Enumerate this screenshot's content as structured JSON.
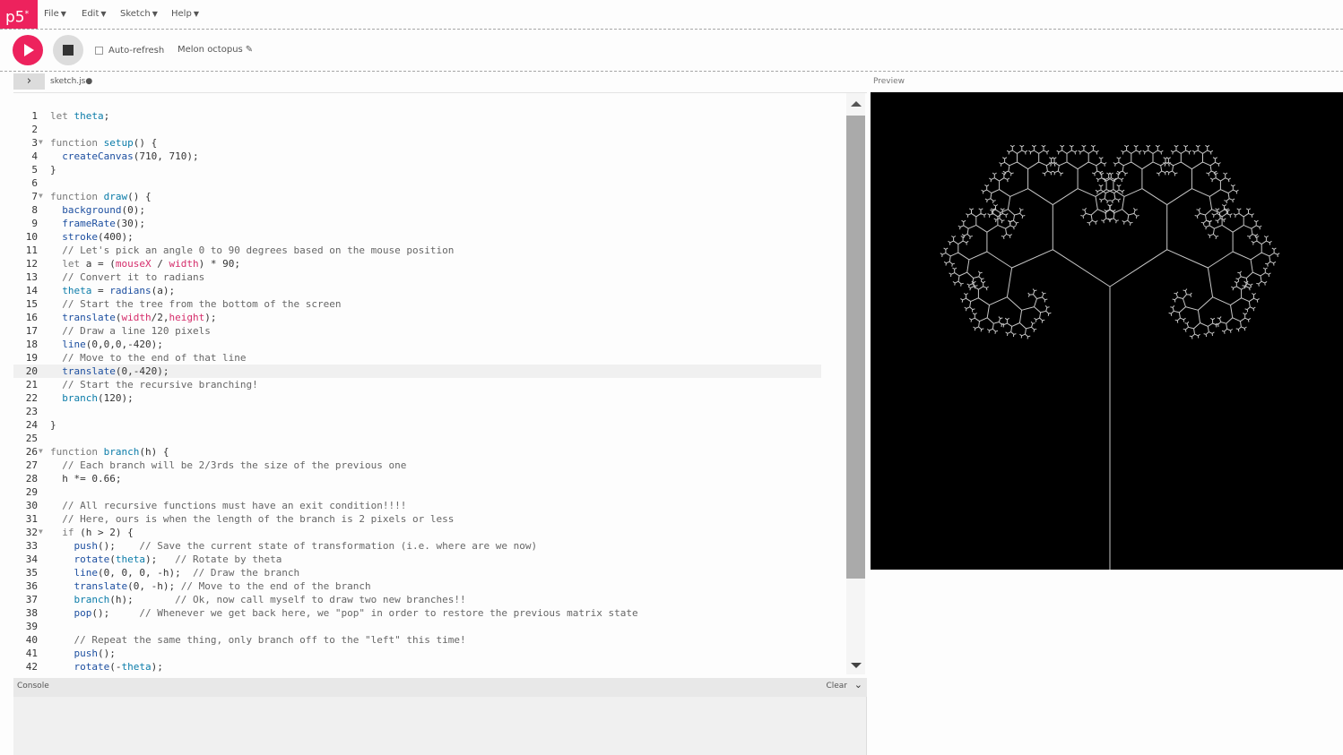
{
  "menubar": {
    "logo": "p5",
    "logo_sup": "*",
    "items": [
      {
        "label": "File"
      },
      {
        "label": "Edit"
      },
      {
        "label": "Sketch"
      },
      {
        "label": "Help"
      }
    ]
  },
  "toolbar": {
    "auto_refresh_label": "Auto-refresh",
    "auto_refresh_checked": false,
    "sketch_name": "Melon octopus"
  },
  "tabs": {
    "file_name": "sketch.js",
    "unsaved_dot": "●"
  },
  "preview": {
    "label": "Preview",
    "background": "#000000",
    "stroke": "#c8c8c8"
  },
  "console": {
    "title": "Console",
    "clear_label": "Clear"
  },
  "editor": {
    "active_line": 20,
    "lines": [
      {
        "n": "1",
        "text": "let theta;"
      },
      {
        "n": "2",
        "text": ""
      },
      {
        "n": "3",
        "text": "function setup() {",
        "fold": true
      },
      {
        "n": "4",
        "text": "  createCanvas(710, 710);"
      },
      {
        "n": "5",
        "text": "}"
      },
      {
        "n": "6",
        "text": ""
      },
      {
        "n": "7",
        "text": "function draw() {",
        "fold": true
      },
      {
        "n": "8",
        "text": "  background(0);"
      },
      {
        "n": "9",
        "text": "  frameRate(30);"
      },
      {
        "n": "10",
        "text": "  stroke(400);"
      },
      {
        "n": "11",
        "text": "  // Let's pick an angle 0 to 90 degrees based on the mouse position"
      },
      {
        "n": "12",
        "text": "  let a = (mouseX / width) * 90;"
      },
      {
        "n": "13",
        "text": "  // Convert it to radians"
      },
      {
        "n": "14",
        "text": "  theta = radians(a);"
      },
      {
        "n": "15",
        "text": "  // Start the tree from the bottom of the screen"
      },
      {
        "n": "16",
        "text": "  translate(width/2,height);"
      },
      {
        "n": "17",
        "text": "  // Draw a line 120 pixels"
      },
      {
        "n": "18",
        "text": "  line(0,0,0,-420);"
      },
      {
        "n": "19",
        "text": "  // Move to the end of that line"
      },
      {
        "n": "20",
        "text": "  translate(0,-420);"
      },
      {
        "n": "21",
        "text": "  // Start the recursive branching!"
      },
      {
        "n": "22",
        "text": "  branch(120);"
      },
      {
        "n": "23",
        "text": ""
      },
      {
        "n": "24",
        "text": "}"
      },
      {
        "n": "25",
        "text": ""
      },
      {
        "n": "26",
        "text": "function branch(h) {",
        "fold": true
      },
      {
        "n": "27",
        "text": "  // Each branch will be 2/3rds the size of the previous one"
      },
      {
        "n": "28",
        "text": "  h *= 0.66;"
      },
      {
        "n": "29",
        "text": ""
      },
      {
        "n": "30",
        "text": "  // All recursive functions must have an exit condition!!!!"
      },
      {
        "n": "31",
        "text": "  // Here, ours is when the length of the branch is 2 pixels or less"
      },
      {
        "n": "32",
        "text": "  if (h > 2) {",
        "fold": true
      },
      {
        "n": "33",
        "text": "    push();    // Save the current state of transformation (i.e. where are we now)"
      },
      {
        "n": "34",
        "text": "    rotate(theta);   // Rotate by theta"
      },
      {
        "n": "35",
        "text": "    line(0, 0, 0, -h);  // Draw the branch"
      },
      {
        "n": "36",
        "text": "    translate(0, -h); // Move to the end of the branch"
      },
      {
        "n": "37",
        "text": "    branch(h);       // Ok, now call myself to draw two new branches!!"
      },
      {
        "n": "38",
        "text": "    pop();     // Whenever we get back here, we \"pop\" in order to restore the previous matrix state"
      },
      {
        "n": "39",
        "text": ""
      },
      {
        "n": "40",
        "text": "    // Repeat the same thing, only branch off to the \"left\" this time!"
      },
      {
        "n": "41",
        "text": "    push();"
      },
      {
        "n": "42",
        "text": "    rotate(-theta);"
      }
    ]
  }
}
